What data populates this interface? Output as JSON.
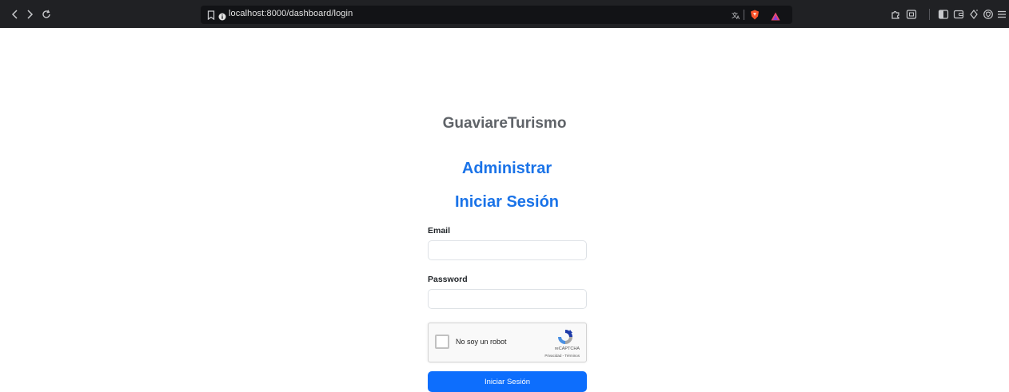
{
  "browser": {
    "url": "localhost:8000/dashboard/login"
  },
  "page": {
    "brand": "GuaviareTurismo",
    "heading_admin": "Administrar",
    "heading_login": "Iniciar Sesión",
    "email_label": "Email",
    "email_value": "",
    "password_label": "Password",
    "password_value": "",
    "recaptcha": {
      "label": "No soy un robot",
      "brand": "reCAPTCHA",
      "links": "Privacidad - Términos"
    },
    "submit_label": "Iniciar Sesión"
  },
  "colors": {
    "accent": "#1a73e8",
    "button": "#0d6efd",
    "toolbar": "#202124"
  }
}
